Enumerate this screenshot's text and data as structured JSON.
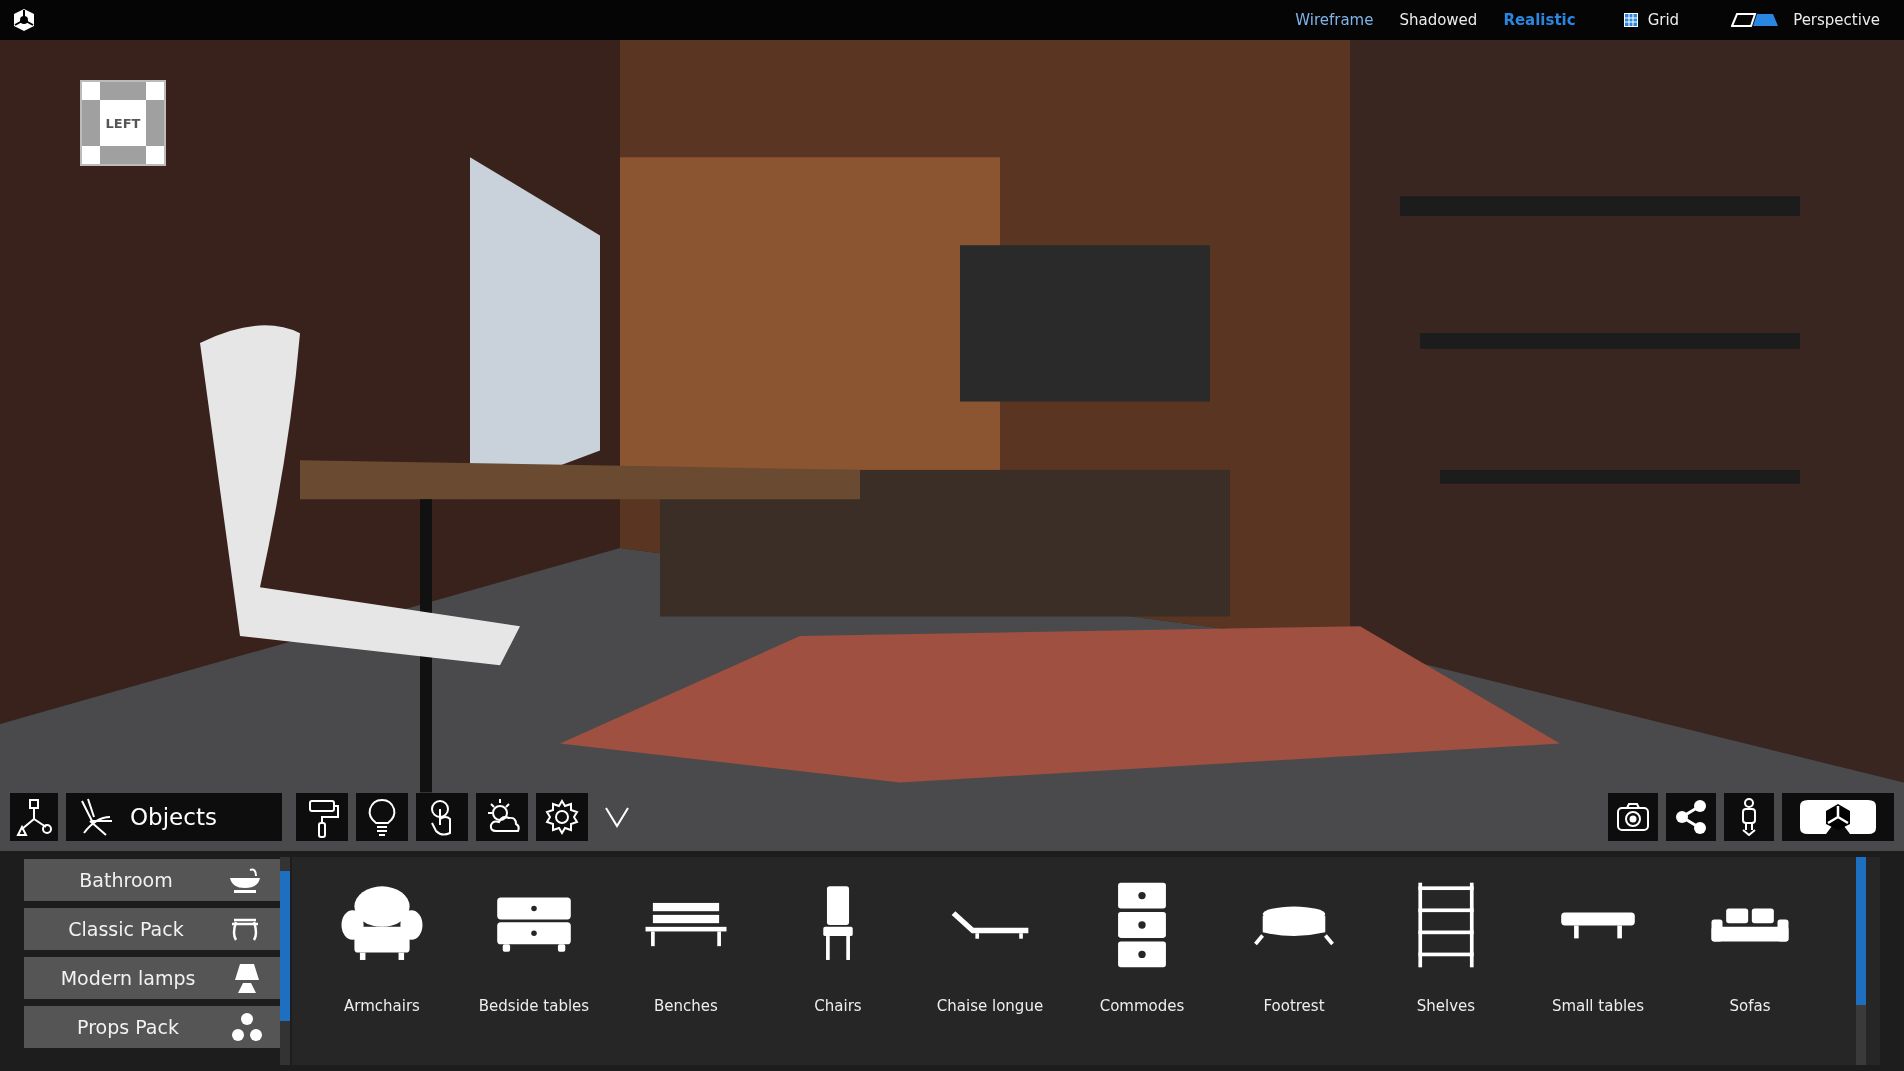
{
  "top_bar": {
    "render_modes": [
      {
        "label": "Wireframe",
        "selected": false,
        "hovered": true
      },
      {
        "label": "Shadowed",
        "selected": false,
        "hovered": false
      },
      {
        "label": "Realistic",
        "selected": true,
        "hovered": false
      }
    ],
    "grid": {
      "label": "Grid",
      "checked": true
    },
    "projection": {
      "label": "Perspective"
    }
  },
  "view_cube": {
    "label": "LEFT"
  },
  "toolbar": {
    "mode_label": "Objects"
  },
  "categories": [
    {
      "label": "Bathroom"
    },
    {
      "label": "Classic Pack"
    },
    {
      "label": "Modern lamps"
    },
    {
      "label": "Props Pack"
    }
  ],
  "items": [
    {
      "label": "Armchairs"
    },
    {
      "label": "Bedside tables"
    },
    {
      "label": "Benches"
    },
    {
      "label": "Chairs"
    },
    {
      "label": "Chaise longue"
    },
    {
      "label": "Commodes"
    },
    {
      "label": "Footrest"
    },
    {
      "label": "Shelves"
    },
    {
      "label": "Small tables"
    },
    {
      "label": "Sofas"
    }
  ]
}
